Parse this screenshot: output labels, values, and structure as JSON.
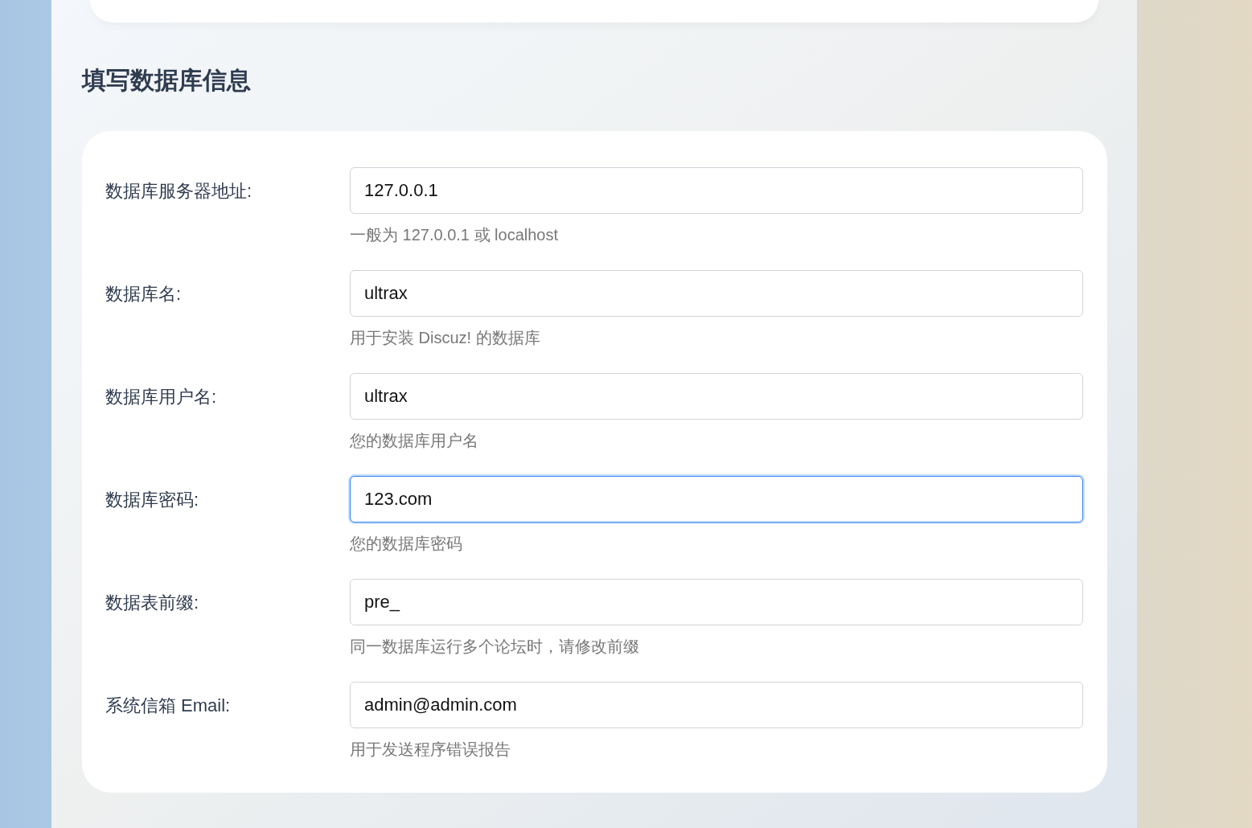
{
  "heading": "填写数据库信息",
  "fields": [
    {
      "label": "数据库服务器地址:",
      "value": "127.0.0.1",
      "hint": "一般为 127.0.0.1 或 localhost",
      "focused": false
    },
    {
      "label": "数据库名:",
      "value": "ultrax",
      "hint": "用于安装 Discuz! 的数据库",
      "focused": false
    },
    {
      "label": "数据库用户名:",
      "value": "ultrax",
      "hint": "您的数据库用户名",
      "focused": false
    },
    {
      "label": "数据库密码:",
      "value": "123.com",
      "hint": "您的数据库密码",
      "focused": true
    },
    {
      "label": "数据表前缀:",
      "value": "pre_",
      "hint": "同一数据库运行多个论坛时，请修改前缀",
      "focused": false
    },
    {
      "label": "系统信箱 Email:",
      "value": "admin@admin.com",
      "hint": "用于发送程序错误报告",
      "focused": false
    }
  ]
}
